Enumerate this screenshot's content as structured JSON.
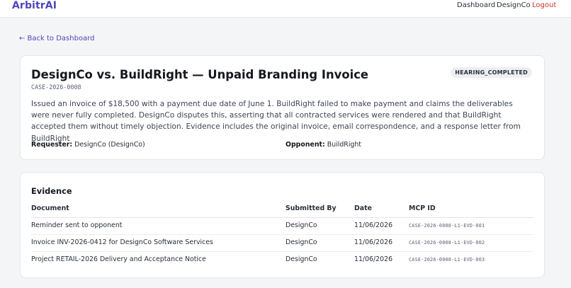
{
  "nav": {
    "brand": "ArbitrAI",
    "links": [
      "Dashboard",
      "DesignCo"
    ],
    "logout": "Logout"
  },
  "back_link": "← Back to Dashboard",
  "case": {
    "title": "DesignCo vs. BuildRight — Unpaid Branding Invoice",
    "id": "CASE-2026-0008",
    "status": "HEARING_COMPLETED",
    "description": "Issued an invoice of $18,500 with a payment due date of June 1. BuildRight failed to make payment and claims the deliverables were never fully completed. DesignCo disputes this, asserting that all contracted services were rendered and that BuildRight accepted them without timely objection. Evidence includes the original invoice, email correspondence, and a response letter from BuildRight",
    "requester_label": "Requester:",
    "requester_value": "DesignCo (DesignCo)",
    "opponent_label": "Opponent:",
    "opponent_value": "BuildRight"
  },
  "evidence": {
    "title": "Evidence",
    "columns": [
      "Document",
      "Submitted By",
      "Date",
      "MCP ID"
    ],
    "rows": [
      {
        "document": "Reminder sent to opponent",
        "submitted_by": "DesignCo",
        "date": "11/06/2026",
        "mcp_id": "CASE-2026-0008-L1-EVD-001"
      },
      {
        "document": "Invoice INV-2026-0412 for DesignCo Software Services",
        "submitted_by": "DesignCo",
        "date": "11/06/2026",
        "mcp_id": "CASE-2026-0008-L1-EVD-002"
      },
      {
        "document": "Project RETAIL-2026 Delivery and Acceptance Notice",
        "submitted_by": "DesignCo",
        "date": "11/06/2026",
        "mcp_id": "CASE-2026-0008-L1-EVD-003"
      }
    ]
  },
  "colors": {
    "brand": "#4f46b8",
    "logout": "#c9352b",
    "background": "#f4f5f7"
  }
}
